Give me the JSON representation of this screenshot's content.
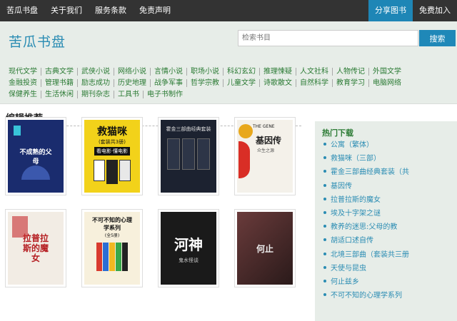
{
  "topnav": {
    "items": [
      "苦瓜书盘",
      "关于我们",
      "服务条款",
      "免责声明"
    ],
    "share": "分享图书",
    "join": "免费加入"
  },
  "header": {
    "logo": "苦瓜书盘",
    "search_placeholder": "检索书目",
    "search_button": "搜索"
  },
  "categories": [
    [
      "现代文学",
      "古典文学",
      "武侠小说",
      "网络小说",
      "言情小说",
      "职场小说",
      "科幻玄幻",
      "推理悚疑",
      "人文社科",
      "人物传记",
      "外国文学"
    ],
    [
      "金融投资",
      "管理书籍",
      "励志成功",
      "历史地理",
      "战争军事",
      "哲学宗教",
      "儿童文学",
      "诗歌散文",
      "自然科学",
      "教育学习",
      "电脑网络"
    ],
    [
      "保健养生",
      "生活休闲",
      "期刊杂志",
      "工具书",
      "电子书制作"
    ]
  ],
  "main": {
    "title": "编辑推荐",
    "books": [
      {
        "title": "不成熟的父母",
        "bg": "#1a2c6e",
        "fg": "#ffffff"
      },
      {
        "title": "救猫咪",
        "sub": "(套装共3册)",
        "small": "看电影·懂电影",
        "bg": "#f2d21a",
        "fg": "#111111"
      },
      {
        "title": "霍金三部曲经典套装",
        "bg": "#1c2230",
        "fg": "#dddddd"
      },
      {
        "title": "基因传",
        "sub": "众生之源",
        "top": "THE GENE",
        "bg": "#f4f1ea",
        "fg": "#222222"
      },
      {
        "title": "拉普拉斯的魔女",
        "bg": "#f2ece4",
        "fg": "#b51e22"
      },
      {
        "title": "不可不知的心理学系列",
        "sub": "(全5册)",
        "bg": "#f7f0dc",
        "fg": "#111111"
      },
      {
        "title": "河神",
        "sub": "鬼水怪谈",
        "bg": "#1a1a1a",
        "fg": "#ffffff"
      },
      {
        "title": "何止",
        "bg": "#4a2a2a",
        "fg": "#eeeeee"
      }
    ]
  },
  "sidebar": {
    "title": "热门下载",
    "items": [
      "公寓（繁体）",
      "救猫咪（三部）",
      "霍金三部曲经典套装（共",
      "基因传",
      "拉普拉斯的魔女",
      "埃及十字架之谜",
      "教养的迷思:父母的教",
      "胡适口述自传",
      "北境三部曲（套装共三册",
      "天使与昆虫",
      "何止兹乡",
      "不可不知的心理学系列"
    ]
  }
}
